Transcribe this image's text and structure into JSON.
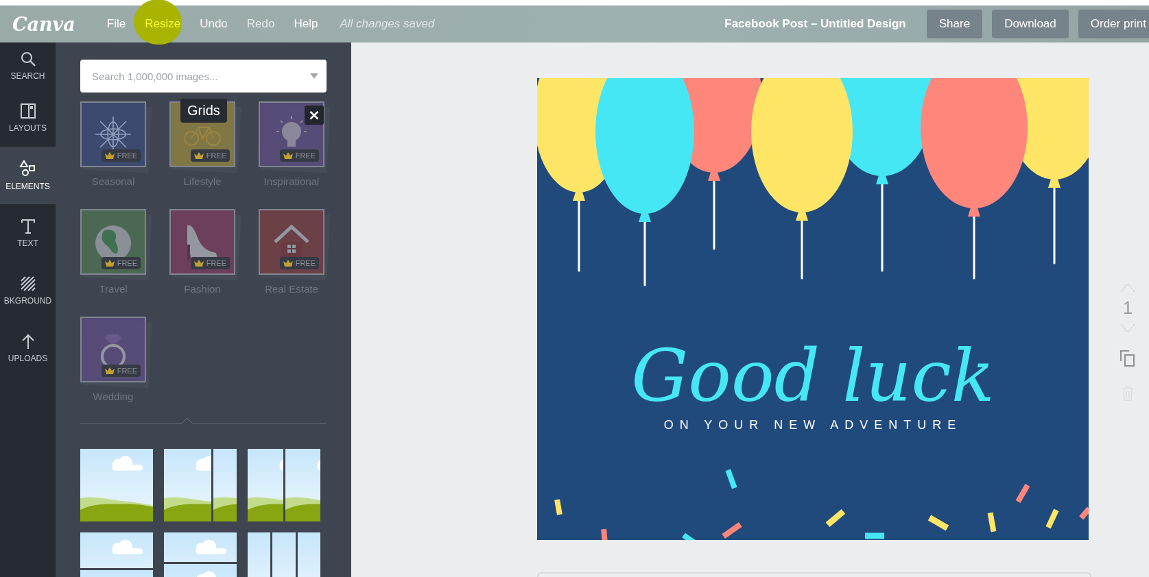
{
  "toolbar": {
    "logo": "Canva",
    "menu": [
      {
        "label": "File",
        "disabled": false,
        "highlighted": false
      },
      {
        "label": "Resize",
        "disabled": false,
        "highlighted": true
      },
      {
        "label": "Undo",
        "disabled": false,
        "highlighted": false
      },
      {
        "label": "Redo",
        "disabled": true,
        "highlighted": false
      },
      {
        "label": "Help",
        "disabled": false,
        "highlighted": false
      }
    ],
    "status": "All changes saved",
    "design_title": "Facebook Post – Untitled Design",
    "actions": [
      "Share",
      "Download",
      "Order print"
    ]
  },
  "sidebar": {
    "items": [
      {
        "kind": "search",
        "label": "SEARCH",
        "selected": false
      },
      {
        "kind": "layouts",
        "label": "LAYOUTS",
        "selected": false
      },
      {
        "kind": "elements",
        "label": "ELEMENTS",
        "selected": true
      },
      {
        "kind": "text",
        "label": "TEXT",
        "selected": false
      },
      {
        "kind": "background",
        "label": "BKGROUND",
        "selected": false
      },
      {
        "kind": "uploads",
        "label": "UPLOADS",
        "selected": false
      }
    ]
  },
  "panel": {
    "search": {
      "placeholder": "Search 1,000,000 images..."
    },
    "tooltip": "Grids",
    "close": "×",
    "categories": [
      {
        "kind": "snowflake",
        "label": "Seasonal",
        "badge": "FREE",
        "color": "#3c4a72"
      },
      {
        "kind": "bicycle",
        "label": "Lifestyle",
        "badge": "FREE",
        "color": "#857a45"
      },
      {
        "kind": "bulb",
        "label": "Inspirational",
        "badge": "FREE",
        "color": "#584c7a"
      },
      {
        "kind": "globe",
        "label": "Travel",
        "badge": "FREE",
        "color": "#4c6b52"
      },
      {
        "kind": "shoe",
        "label": "Fashion",
        "badge": "FREE",
        "color": "#6f3f5e"
      },
      {
        "kind": "house",
        "label": "Real Estate",
        "badge": "FREE",
        "color": "#6e4046"
      },
      {
        "kind": "ring",
        "label": "Wedding",
        "badge": "FREE",
        "color": "#584c7a"
      }
    ],
    "layouts": [
      {
        "kind": "single"
      },
      {
        "kind": "wide-narrow"
      },
      {
        "kind": "halves"
      },
      {
        "kind": "stacked"
      },
      {
        "kind": "stacked-short"
      },
      {
        "kind": "thirds"
      }
    ]
  },
  "design": {
    "headline": "Good luck",
    "subline": "ON YOUR NEW ADVENTURE"
  },
  "page_controls": {
    "page_number": "1"
  }
}
